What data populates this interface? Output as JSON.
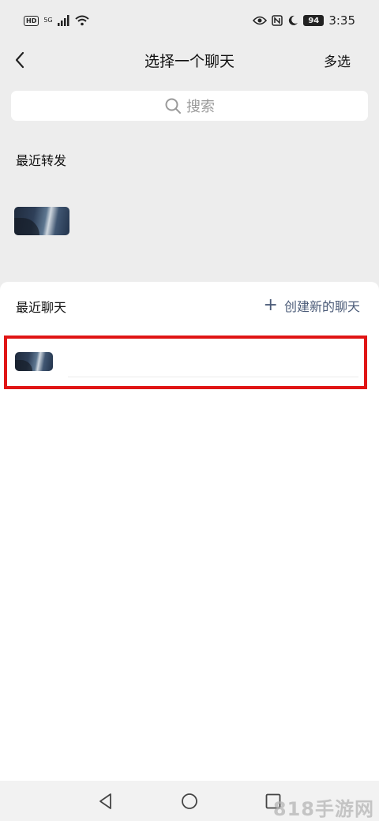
{
  "status_bar": {
    "hd": "HD",
    "network": "5G",
    "time": "3:35",
    "battery": "94"
  },
  "header": {
    "title": "选择一个聊天",
    "multi_select": "多选"
  },
  "search": {
    "placeholder": "搜索"
  },
  "recent_forward": {
    "label": "最近转发"
  },
  "recent_chats": {
    "label": "最近聊天",
    "create_new": "创建新的聊天"
  },
  "watermark": "818手游网",
  "colors": {
    "background": "#ededed",
    "sheet": "#ffffff",
    "link": "#4b5b78",
    "highlight": "#e01515"
  }
}
